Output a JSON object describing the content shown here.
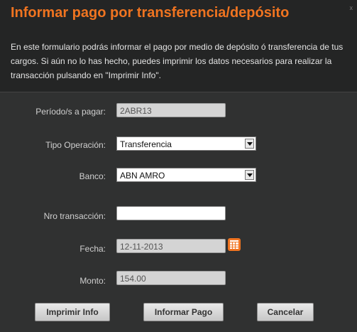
{
  "dialog": {
    "title": "Informar pago por transferencia/depósito",
    "close_label": "x",
    "description": "En este formulario podrás informar el pago por medio de depósito ó transferencia de tus cargos. Si aún no lo has hecho, puedes imprimir los datos necesarios para realizar la transacción pulsando en \"Imprimir Info\"."
  },
  "form": {
    "periodo": {
      "label": "Período/s a pagar:",
      "value": "2ABR13"
    },
    "tipo_operacion": {
      "label": "Tipo Operación:",
      "value": "Transferencia"
    },
    "banco": {
      "label": "Banco:",
      "value": "ABN AMRO"
    },
    "nro_transaccion": {
      "label": "Nro transacción:",
      "value": ""
    },
    "fecha": {
      "label": "Fecha:",
      "value": "12-11-2013"
    },
    "monto": {
      "label": "Monto:",
      "value": "154.00"
    }
  },
  "buttons": {
    "imprimir": "Imprimir Info",
    "informar": "Informar Pago",
    "cancelar": "Cancelar"
  },
  "icons": {
    "calendar": "calendar-icon",
    "select_arrow": "chevron-down-icon"
  },
  "colors": {
    "accent": "#f07420",
    "background": "#303131",
    "header_background": "#242525"
  }
}
